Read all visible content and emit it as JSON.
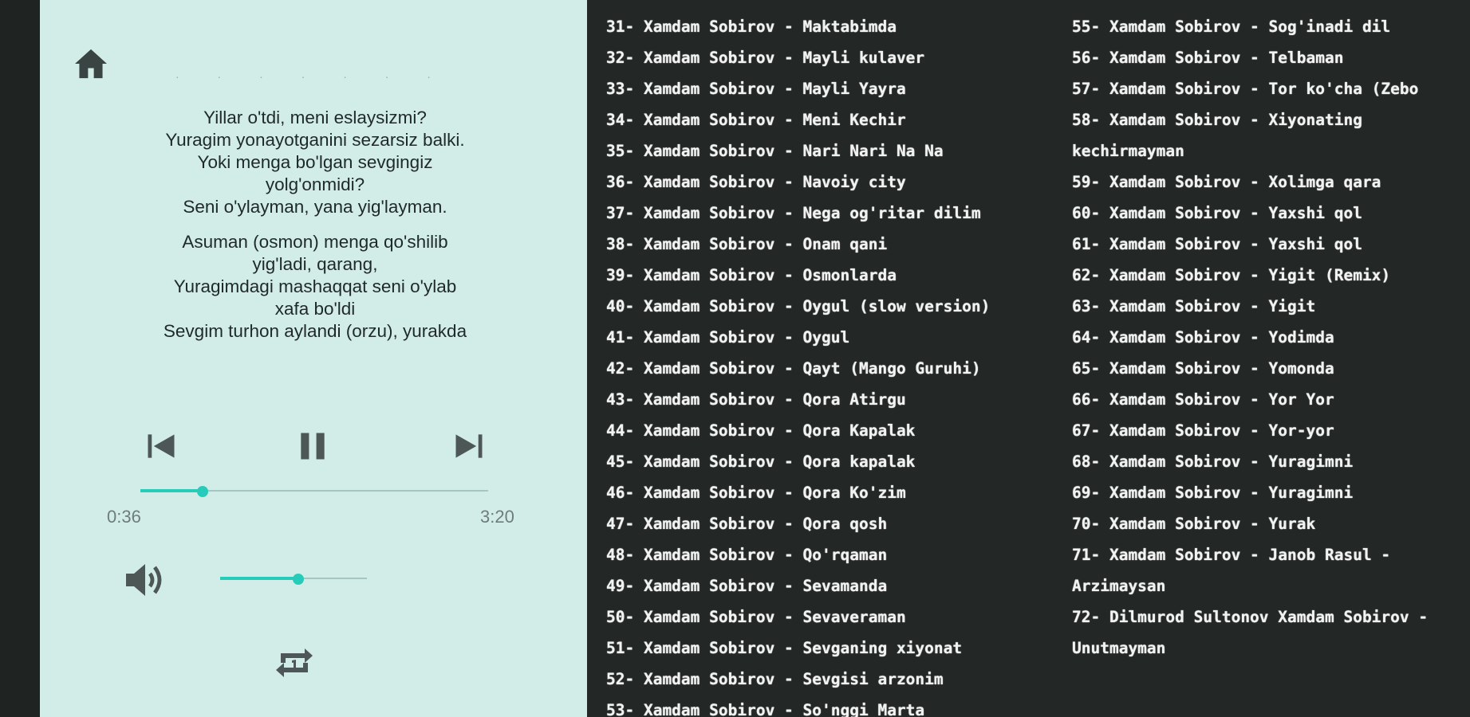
{
  "player": {
    "faded_title": "· · · · · · ·",
    "lyrics": [
      [
        "Yillar o'tdi, meni eslaysizmi?",
        "Yuragim yonayotganini sezarsiz balki.",
        "Yoki menga bo'lgan sevgingiz",
        "yolg'onmidi?",
        "Seni o'ylayman, yana yig'layman."
      ],
      [
        "Asuman (osmon) menga qo'shilib",
        "yig'ladi, qarang,",
        "Yuragimdagi mashaqqat seni o'ylab",
        "xafa bo'ldi",
        "Sevgim turhon aylandi (orzu), yurakda"
      ]
    ],
    "time_elapsed": "0:36",
    "time_total": "3:20",
    "progress_fraction": 0.18,
    "volume_fraction": 0.53,
    "icons": [
      "home-icon",
      "skip-previous-icon",
      "pause-icon",
      "skip-next-icon",
      "volume-icon",
      "repeat-one-icon"
    ],
    "accent_color": "#27cbb9",
    "panel_color": "#d2ede8"
  },
  "playlist": {
    "column1": [
      "31- Xamdam Sobirov - Maktabimda",
      "32- Xamdam Sobirov - Mayli kulaver",
      "33- Xamdam Sobirov - Mayli Yayra",
      "34- Xamdam Sobirov - Meni Kechir",
      "35- Xamdam Sobirov - Nari Nari Na Na",
      "36- Xamdam Sobirov - Navoiy city",
      "37- Xamdam Sobirov - Nega og'ritar dilim",
      "38- Xamdam Sobirov - Onam qani",
      "39- Xamdam Sobirov - Osmonlarda",
      "40- Xamdam Sobirov - Oygul (slow version)",
      "41- Xamdam Sobirov - Oygul",
      "42- Xamdam Sobirov - Qayt (Mango Guruhi)",
      "43- Xamdam Sobirov - Qora Atirgu",
      "44- Xamdam Sobirov - Qora Kapalak",
      "45- Xamdam Sobirov - Qora kapalak",
      "46- Xamdam Sobirov - Qora Ko'zim",
      "47- Xamdam Sobirov - Qora qosh",
      "48- Xamdam Sobirov - Qo'rqaman",
      "49- Xamdam Sobirov - Sevamanda",
      "50- Xamdam Sobirov - Sevaveraman",
      "51- Xamdam Sobirov - Sevganing xiyonat",
      "52- Xamdam Sobirov - Sevgisi arzonim",
      "53- Xamdam Sobirov - So'nggi Marta"
    ],
    "column2": [
      "55- Xamdam Sobirov - Sog'inadi dil",
      "56- Xamdam Sobirov - Telbaman",
      "57- Xamdam Sobirov - Tor ko'cha (Zebo",
      "58- Xamdam Sobirov - Xiyonating",
      "kechirmayman",
      "59- Xamdam Sobirov - Xolimga qara",
      "60- Xamdam Sobirov - Yaxshi qol",
      "61- Xamdam Sobirov - Yaxshi qol",
      "62- Xamdam Sobirov - Yigit (Remix)",
      "63- Xamdam Sobirov - Yigit",
      "64- Xamdam Sobirov - Yodimda",
      "65- Xamdam Sobirov - Yomonda",
      "66- Xamdam Sobirov - Yor Yor",
      "67- Xamdam Sobirov - Yor-yor",
      "68- Xamdam Sobirov - Yuragimni",
      "69- Xamdam Sobirov - Yuragimni",
      "70- Xamdam Sobirov - Yurak",
      "71- Xamdam Sobirov - Janob Rasul -",
      "Arzimaysan",
      "72- Dilmurod Sultonov Xamdam Sobirov -",
      "Unutmayman"
    ]
  }
}
